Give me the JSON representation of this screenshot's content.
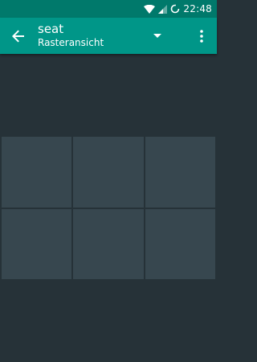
{
  "status_bar": {
    "time": "22:48",
    "icons": [
      "wifi-icon",
      "cell-signal-icon",
      "battery-icon"
    ]
  },
  "app_bar": {
    "title": "seat",
    "subtitle": "Rasteransicht",
    "icons": [
      "arrow-back-icon",
      "dropdown-arrow-icon",
      "more-vert-icon"
    ]
  },
  "grid": {
    "rows": 2,
    "columns": 3,
    "cells": [
      {
        "row": 1,
        "column": 1
      },
      {
        "row": 1,
        "column": 2
      },
      {
        "row": 1,
        "column": 3
      },
      {
        "row": 2,
        "column": 1
      },
      {
        "row": 2,
        "column": 2
      },
      {
        "row": 2,
        "column": 3
      }
    ]
  },
  "colors": {
    "status_bar": "#00796b",
    "app_bar": "#009688",
    "background": "#263238",
    "cell": "#37474f"
  }
}
